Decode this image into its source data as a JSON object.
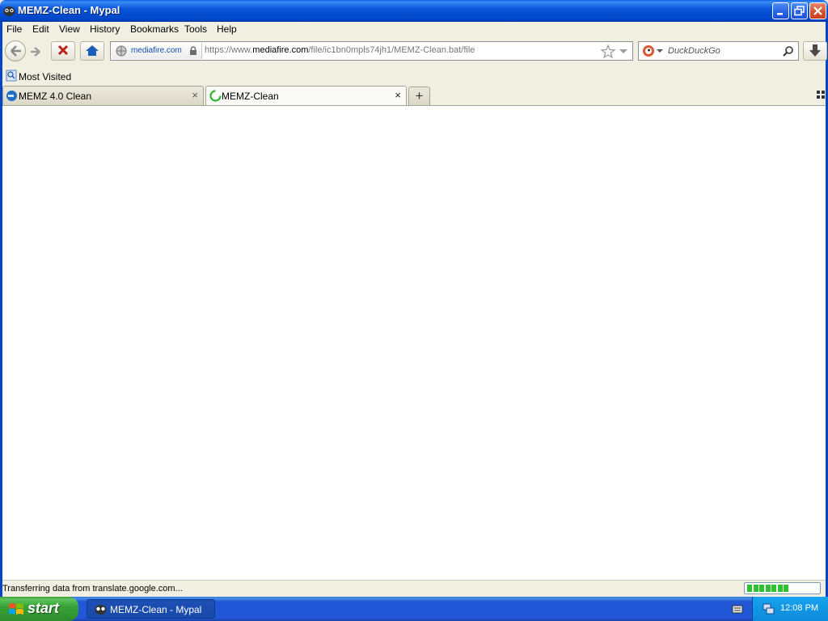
{
  "window": {
    "title": "MEMZ-Clean - Mypal"
  },
  "menu": {
    "items": [
      {
        "label": "File"
      },
      {
        "label": "Edit"
      },
      {
        "label": "View"
      },
      {
        "label": "History"
      },
      {
        "label": "Bookmarks"
      },
      {
        "label": "Tools"
      },
      {
        "label": "Help"
      }
    ]
  },
  "urlbar": {
    "site_identity": "mediafire.com",
    "url_prefix": "https://www.",
    "url_domain": "mediafire.com",
    "url_path": "/file/ic1bn0mpls74jh1/MEMZ-Clean.bat/file"
  },
  "search": {
    "placeholder": "DuckDuckGo"
  },
  "bookmarks": {
    "items": [
      {
        "label": "Most Visited"
      }
    ]
  },
  "tabs": [
    {
      "label": "MEMZ 4.0 Clean",
      "active": false
    },
    {
      "label": "MEMZ-Clean",
      "active": true
    }
  ],
  "newtab": {
    "label": "+"
  },
  "status": {
    "text": "Transferring data from translate.google.com..."
  },
  "taskbar": {
    "start_label": "start",
    "task_label": "MEMZ-Clean - Mypal",
    "clock": "12:08 PM"
  },
  "progress": {
    "fraction": 0.55
  }
}
